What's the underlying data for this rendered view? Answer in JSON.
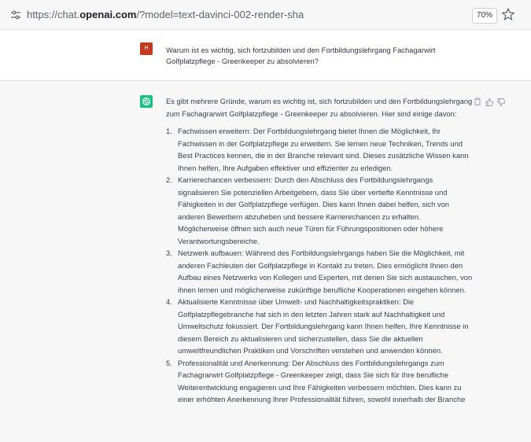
{
  "browser": {
    "url_prefix": "https://chat.",
    "url_domain": "openai.com",
    "url_path": "/?model=text-davinci-002-render-sha",
    "zoom": "70%"
  },
  "user_message": {
    "avatar_initial": "H",
    "text": "Warum ist es wichtig, sich fortzubilden und den Fortbildungslehrgang Fachagarwirt Golfplatzpflege - Greenkeeper zu absolvieren?"
  },
  "assistant_message": {
    "intro": "Es gibt mehrere Gründe, warum es wichtig ist, sich fortzubilden und den Fortbildungslehrgang zum Fachagrarwirt Golfplatzpflege - Greenkeeper zu absolvieren. Hier sind einige davon:",
    "points": [
      {
        "num": "1.",
        "text": "Fachwissen erweitern: Der Fortbildungslehrgang bietet Ihnen die Möglichkeit, Ihr Fachwissen in der Golfplatzpflege zu erweitern. Sie lernen neue Techniken, Trends und Best Practices kennen, die in der Branche relevant sind. Dieses zusätzliche Wissen kann Ihnen helfen, Ihre Aufgaben effektiver und effizienter zu erledigen."
      },
      {
        "num": "2.",
        "text": "Karrierechancen verbessern: Durch den Abschluss des Fortbildungslehrgangs signalisieren Sie potenziellen Arbeitgebern, dass Sie über vertiefte Kenntnisse und Fähigkeiten in der Golfplatzpflege verfügen. Dies kann Ihnen dabei helfen, sich von anderen Bewerbern abzuheben und bessere Karrierechancen zu erhalten. Möglicherweise öffnen sich auch neue Türen für Führungspositionen oder höhere Verantwortungsbereiche."
      },
      {
        "num": "3.",
        "text": "Netzwerk aufbauen: Während des Fortbildungslehrgangs haben Sie die Möglichkeit, mit anderen Fachleuten der Golfplatzpflege in Kontakt zu treten. Dies ermöglicht Ihnen den Aufbau eines Netzwerks von Kollegen und Experten, mit denen Sie sich austauschen, von ihnen lernen und möglicherweise zukünftige berufliche Kooperationen eingehen können."
      },
      {
        "num": "4.",
        "text": "Aktualisierte Kenntnisse über Umwelt- und Nachhaltigkeitspraktiken: Die Golfplatzpflegebranche hat sich in den letzten Jahren stark auf Nachhaltigkeit und Umweltschutz fokussiert. Der Fortbildungslehrgang kann Ihnen helfen, Ihre Kenntnisse in diesem Bereich zu aktualisieren und sicherzustellen, dass Sie die aktuellen umweltfreundlichen Praktiken und Vorschriften verstehen und anwenden können."
      },
      {
        "num": "5.",
        "text": "Professionalität und Anerkennung: Der Abschluss des Fortbildungslehrgangs zum Fachagrarwirt Golfplatzpflege - Greenkeeper zeigt, dass Sie sich für Ihre berufliche Weiterentwicklung engagieren und Ihre Fähigkeiten verbessern möchten. Dies kann zu einer erhöhten Anerkennung Ihrer Professionalität führen, sowohl innerhalb der Branche"
      }
    ]
  },
  "icons": {
    "site": "site-settings-icon",
    "bookmark": "star-icon",
    "copy": "copy-icon",
    "like": "thumbs-up-icon",
    "dislike": "thumbs-down-icon",
    "bot": "openai-logo-icon"
  },
  "colors": {
    "user_avatar": "#c23b1e",
    "bot_avatar": "#19c37d",
    "assistant_bg": "#f7f7f8"
  }
}
